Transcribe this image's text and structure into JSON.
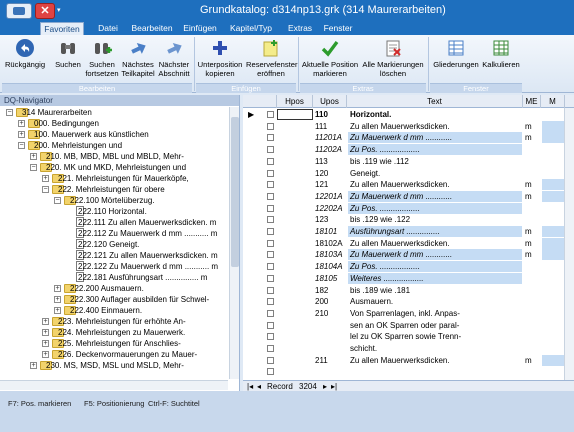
{
  "title": "Grundkatalog:  d314np13.grk (314 Maurerarbeiten)",
  "tabs": [
    "Favoriten",
    "Datei",
    "Bearbeiten",
    "Einfügen",
    "Kapitel/Typ",
    "Extras",
    "Fenster"
  ],
  "ribbon": {
    "buttons": [
      {
        "label1": "Rückgängig",
        "label2": ""
      },
      {
        "label1": "Suchen",
        "label2": ""
      },
      {
        "label1": "Suchen",
        "label2": "fortsetzen"
      },
      {
        "label1": "Nächstes",
        "label2": "Teilkapitel"
      },
      {
        "label1": "Nächster",
        "label2": "Abschnitt"
      },
      {
        "label1": "Unterposition",
        "label2": "kopieren"
      },
      {
        "label1": "Reservefenster",
        "label2": "eröffnen"
      },
      {
        "label1": "Aktuelle Position",
        "label2": "markieren"
      },
      {
        "label1": "Alle Markierungen",
        "label2": "löschen"
      },
      {
        "label1": "Gliederungen",
        "label2": ""
      },
      {
        "label1": "Kalkulieren",
        "label2": ""
      }
    ],
    "groups": [
      "Bearbeiten",
      "Einfügen",
      "Extras",
      "Fenster"
    ]
  },
  "navigator": {
    "title": "DQ-Navigator",
    "items": [
      {
        "level": 0,
        "type": "folder",
        "exp": "-",
        "text": "314 Maurerarbeiten"
      },
      {
        "level": 1,
        "type": "folder",
        "exp": "+",
        "text": "000.   Bedingungen"
      },
      {
        "level": 1,
        "type": "folder",
        "exp": "+",
        "text": "100.   Mauerwerk aus künstlichen"
      },
      {
        "level": 1,
        "type": "folder",
        "exp": "-",
        "text": "200.   Mehrleistungen und"
      },
      {
        "level": 2,
        "type": "folder",
        "exp": "+",
        "text": "210.   MB, MBD, MBL und MBLD, Mehr-"
      },
      {
        "level": 2,
        "type": "folder",
        "exp": "-",
        "text": "220.   MK und MKD, Mehrleistungen und"
      },
      {
        "level": 3,
        "type": "folder",
        "exp": "+",
        "text": "221.   Mehrleistungen für Mauerköpfe,"
      },
      {
        "level": 3,
        "type": "folder",
        "exp": "-",
        "text": "222.   Mehrleistungen für obere"
      },
      {
        "level": 4,
        "type": "folder",
        "exp": "-",
        "text": "222.100 Mörtelüberzug."
      },
      {
        "level": 5,
        "type": "doc",
        "exp": "",
        "text": "222.110 Horizontal."
      },
      {
        "level": 5,
        "type": "doc",
        "exp": "",
        "text": "222.111 Zu allen Mauerwerksdicken.       m"
      },
      {
        "level": 5,
        "type": "doc",
        "exp": "",
        "text": "222.112 Zu Mauerwerk d mm ...........     m"
      },
      {
        "level": 5,
        "type": "doc",
        "exp": "",
        "text": "222.120 Geneigt."
      },
      {
        "level": 5,
        "type": "doc",
        "exp": "",
        "text": "222.121 Zu allen Mauerwerksdicken.       m"
      },
      {
        "level": 5,
        "type": "doc",
        "exp": "",
        "text": "222.122 Zu Mauerwerk d mm ...........     m"
      },
      {
        "level": 5,
        "type": "doc",
        "exp": "",
        "text": "222.181 Ausführungsart ...............      m"
      },
      {
        "level": 4,
        "type": "folder",
        "exp": "+",
        "text": "222.200 Ausmauern."
      },
      {
        "level": 4,
        "type": "folder",
        "exp": "+",
        "text": "222.300 Auflager ausbilden für Schwel-"
      },
      {
        "level": 4,
        "type": "folder",
        "exp": "+",
        "text": "222.400 Einmauern."
      },
      {
        "level": 3,
        "type": "folder",
        "exp": "+",
        "text": "223.   Mehrleistungen für erhöhte An-"
      },
      {
        "level": 3,
        "type": "folder",
        "exp": "+",
        "text": "224.   Mehrleistungen zu Mauerwerk."
      },
      {
        "level": 3,
        "type": "folder",
        "exp": "+",
        "text": "225.   Mehrleistungen für Anschlies-"
      },
      {
        "level": 3,
        "type": "folder",
        "exp": "+",
        "text": "226.   Deckenvormauerungen zu Mauer-"
      },
      {
        "level": 2,
        "type": "folder",
        "exp": "+",
        "text": "230.   MS, MSD, MSL und MSLD, Mehr-"
      }
    ]
  },
  "grid": {
    "headers": [
      "Hpos",
      "Upos",
      "Text",
      "ME",
      "M"
    ],
    "rows": [
      {
        "upos": "110",
        "text": "Horizontal.",
        "me": "",
        "bold": true,
        "hl": false,
        "ital": false,
        "current": true
      },
      {
        "upos": "111",
        "text": "Zu allen Mauerwerksdicken.",
        "me": "m",
        "bold": false,
        "hl": false,
        "ital": false
      },
      {
        "upos": "11201A",
        "text": "Zu Mauerwerk d mm ............",
        "me": "m",
        "bold": false,
        "hl": true,
        "ital": true
      },
      {
        "upos": "11202A",
        "text": "Zu Pos. ..................",
        "me": "",
        "bold": false,
        "hl": true,
        "ital": true
      },
      {
        "upos": "113",
        "text": "bis .119 wie .112",
        "me": "",
        "bold": false,
        "hl": false,
        "ital": false
      },
      {
        "upos": "120",
        "text": "Geneigt.",
        "me": "",
        "bold": false,
        "hl": false,
        "ital": false
      },
      {
        "upos": "121",
        "text": "Zu allen Mauerwerksdicken.",
        "me": "m",
        "bold": false,
        "hl": false,
        "ital": false
      },
      {
        "upos": "12201A",
        "text": "Zu Mauerwerk d mm ............",
        "me": "m",
        "bold": false,
        "hl": true,
        "ital": true
      },
      {
        "upos": "12202A",
        "text": "Zu Pos. ..................",
        "me": "",
        "bold": false,
        "hl": true,
        "ital": true
      },
      {
        "upos": "123",
        "text": "bis .129 wie .122",
        "me": "",
        "bold": false,
        "hl": false,
        "ital": false
      },
      {
        "upos": "18101",
        "text": "Ausführungsart ...............",
        "me": "m",
        "bold": false,
        "hl": true,
        "ital": true
      },
      {
        "upos": "18102A",
        "text": "Zu allen Mauerwerksdicken.",
        "me": "m",
        "bold": false,
        "hl": false,
        "ital": false
      },
      {
        "upos": "18103A",
        "text": "Zu Mauerwerk d mm ............",
        "me": "m",
        "bold": false,
        "hl": true,
        "ital": true
      },
      {
        "upos": "18104A",
        "text": "Zu Pos. ..................",
        "me": "",
        "bold": false,
        "hl": true,
        "ital": true
      },
      {
        "upos": "18105",
        "text": "Weiteres ..................",
        "me": "",
        "bold": false,
        "hl": true,
        "ital": true
      },
      {
        "upos": "182",
        "text": "bis .189 wie .181",
        "me": "",
        "bold": false,
        "hl": false,
        "ital": false
      },
      {
        "upos": "200",
        "text": "Ausmauern.",
        "me": "",
        "bold": false,
        "hl": false,
        "ital": false
      },
      {
        "upos": "210",
        "text": "Von Sparrenlagen, inkl. Anpas-",
        "me": "",
        "bold": false,
        "hl": false,
        "ital": false
      },
      {
        "upos": "",
        "text": "sen an OK Sparren oder paral-",
        "me": "",
        "bold": false,
        "hl": false,
        "ital": false
      },
      {
        "upos": "",
        "text": "lel zu OK Sparren sowie Trenn-",
        "me": "",
        "bold": false,
        "hl": false,
        "ital": false
      },
      {
        "upos": "",
        "text": "schicht.",
        "me": "",
        "bold": false,
        "hl": false,
        "ital": false
      },
      {
        "upos": "211",
        "text": "Zu allen Mauerwerksdicken.",
        "me": "m",
        "bold": false,
        "hl": false,
        "ital": false
      },
      {
        "upos": "",
        "text": "",
        "me": "",
        "bold": false,
        "hl": false,
        "ital": false
      }
    ],
    "footer": {
      "record_label": "Record",
      "record_value": "3204"
    }
  },
  "status": {
    "items": [
      "F7: Pos. markieren",
      "F5: Positionierung",
      "Ctrl-F: Suchtitel"
    ]
  }
}
